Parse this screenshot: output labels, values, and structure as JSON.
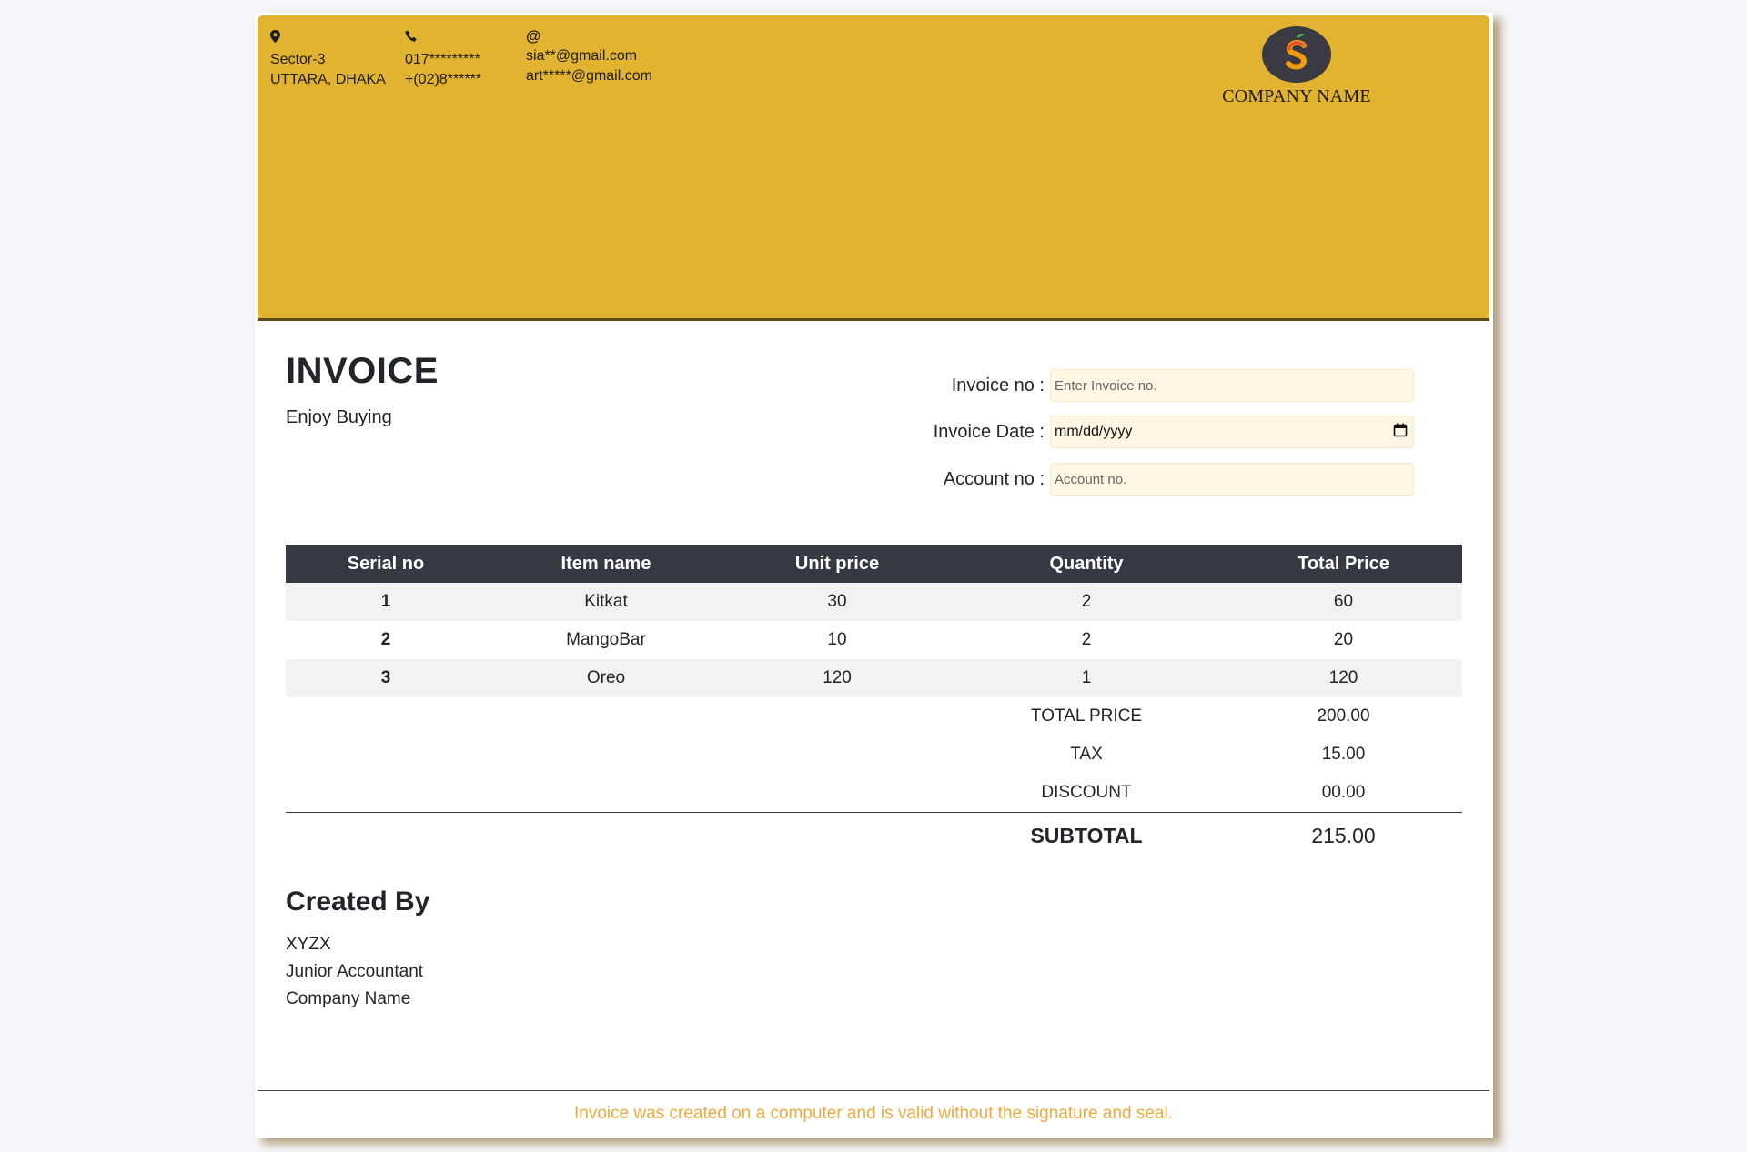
{
  "header": {
    "address": {
      "icon": "location-pin-icon",
      "line1": "Sector-3",
      "line2": "UTTARA, DHAKA"
    },
    "phone": {
      "icon": "phone-icon",
      "line1": "017*********",
      "line2": "+(02)8******"
    },
    "email": {
      "icon": "at-sign-icon",
      "glyph": "@",
      "line1": "sia**@gmail.com",
      "line2": "art*****@gmail.com"
    },
    "logo": {
      "icon": "company-logo-icon"
    },
    "company_name": "COMPANY NAME"
  },
  "invoice": {
    "title": "INVOICE",
    "tagline": "Enjoy Buying",
    "fields": {
      "invoice_no_label": "Invoice no :",
      "invoice_no_placeholder": "Enter Invoice no.",
      "invoice_date_label": "Invoice Date :",
      "invoice_date_value": "mm/dd/yyyy",
      "account_no_label": "Account no :",
      "account_no_placeholder": "Account no."
    }
  },
  "table": {
    "headers": [
      "Serial no",
      "Item name",
      "Unit price",
      "Quantity",
      "Total Price"
    ],
    "rows": [
      {
        "serial": "1",
        "item": "Kitkat",
        "unit_price": "30",
        "quantity": "2",
        "total": "60"
      },
      {
        "serial": "2",
        "item": "MangoBar",
        "unit_price": "10",
        "quantity": "2",
        "total": "20"
      },
      {
        "serial": "3",
        "item": "Oreo",
        "unit_price": "120",
        "quantity": "1",
        "total": "120"
      }
    ],
    "summary": {
      "total_price_label": "TOTAL PRICE",
      "total_price_value": "200.00",
      "tax_label": "TAX",
      "tax_value": "15.00",
      "discount_label": "DISCOUNT",
      "discount_value": "00.00",
      "subtotal_label": "SUBTOTAL",
      "subtotal_value": "215.00"
    }
  },
  "created_by": {
    "title": "Created By",
    "name": "XYZX",
    "role": "Junior Accountant",
    "company": "Company Name"
  },
  "footer": {
    "note": "Invoice was created on a computer and is valid without the signature and seal."
  },
  "colors": {
    "header_band": "#e2b331",
    "table_header": "#343a40",
    "input_background": "#fdf6e3",
    "footer_note": "#f0a93c",
    "page_background": "#f6f6fb"
  }
}
